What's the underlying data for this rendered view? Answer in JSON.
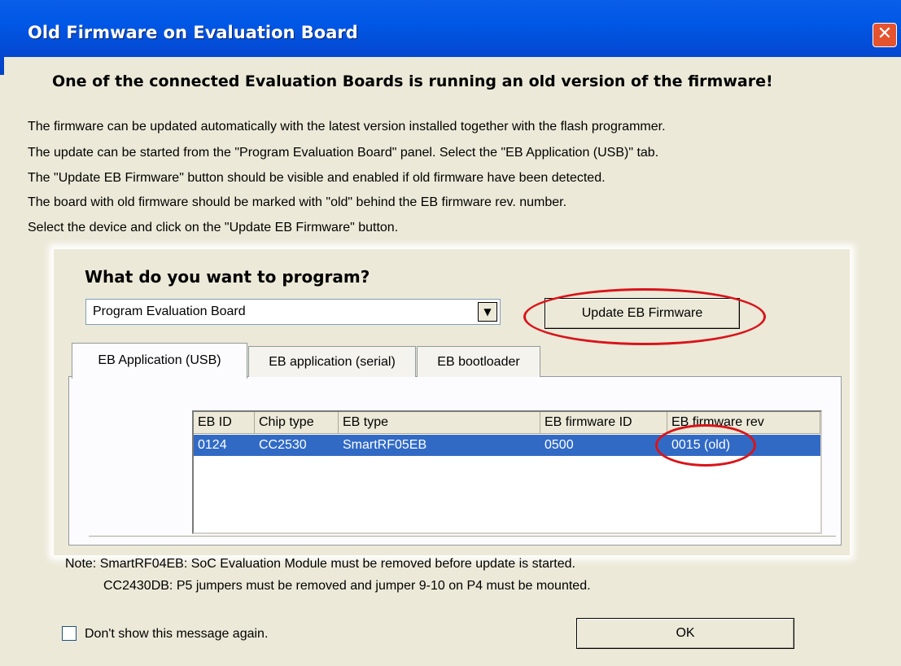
{
  "window": {
    "title": "Old Firmware on Evaluation Board",
    "close_symbol": "✕"
  },
  "heading": "One of the connected Evaluation Boards is running an old version of the firmware!",
  "paragraphs": [
    "The firmware can be updated automatically with the latest version installed together with the flash programmer.",
    "The update can be started from the \"Program Evaluation Board\" panel. Select the \"EB Application (USB)\" tab.",
    "The \"Update EB Firmware\" button should be visible and enabled if old firmware have been detected.",
    "The board with old firmware should be marked with \"old\" behind the EB firmware rev. number.",
    "Select the device and click on the \"Update EB Firmware\" button."
  ],
  "panel": {
    "question": "What do you want to program?",
    "combo_value": "Program Evaluation Board",
    "combo_arrow": "▼",
    "update_button": "Update EB Firmware",
    "tabs": [
      "EB Application (USB)",
      "EB application (serial)",
      "EB bootloader"
    ],
    "table": {
      "headers": [
        "EB ID",
        "Chip type",
        "EB type",
        "EB firmware ID",
        "EB firmware rev"
      ],
      "rows": [
        [
          "0124",
          "CC2530",
          "SmartRF05EB",
          "0500",
          "0015 (old)"
        ]
      ]
    }
  },
  "notes": [
    "Note: SmartRF04EB: SoC Evaluation Module must be removed before update is started.",
    "CC2430DB: P5 jumpers must be removed and jumper 9-10 on P4 must be mounted."
  ],
  "checkbox_label": "Don't show this message again.",
  "ok_button": "OK",
  "colors": {
    "titlebar": "#0449d3",
    "highlight": "#316ac5",
    "annotation": "#d9141a"
  }
}
